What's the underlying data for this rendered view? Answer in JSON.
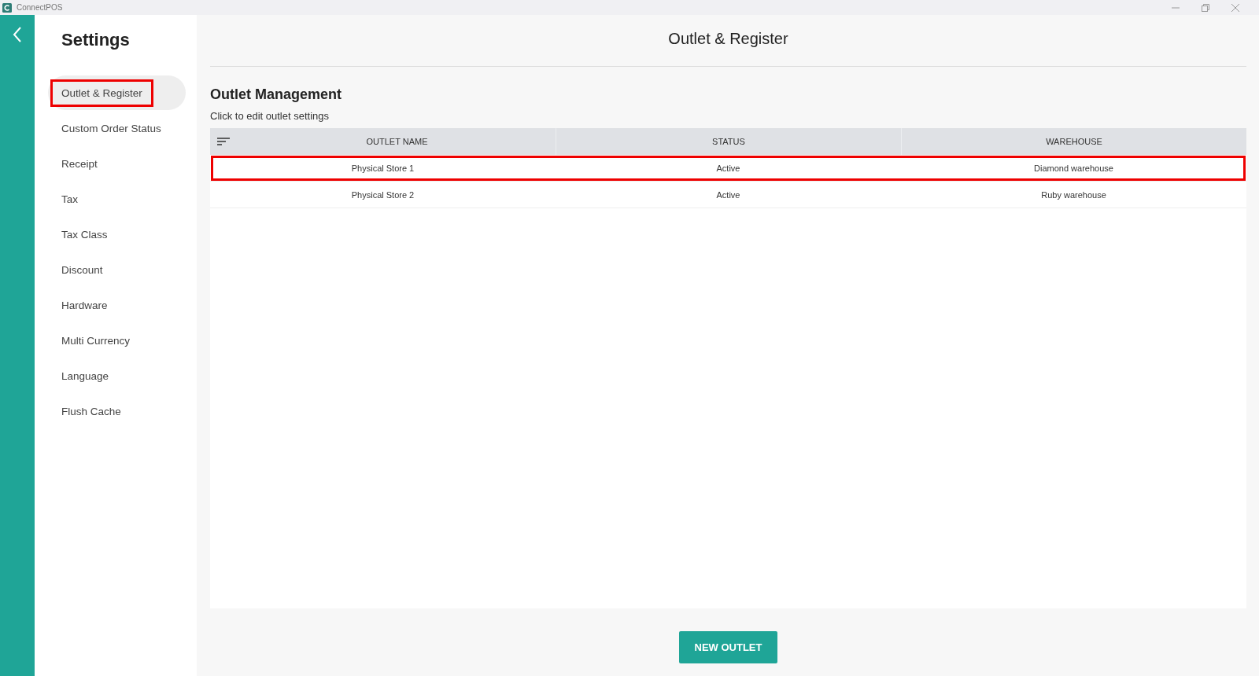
{
  "window": {
    "title": "ConnectPOS"
  },
  "sidebar": {
    "title": "Settings",
    "items": [
      {
        "label": "Outlet & Register",
        "selected": true,
        "highlighted": true
      },
      {
        "label": "Custom Order Status",
        "selected": false,
        "highlighted": false
      },
      {
        "label": "Receipt",
        "selected": false,
        "highlighted": false
      },
      {
        "label": "Tax",
        "selected": false,
        "highlighted": false
      },
      {
        "label": "Tax Class",
        "selected": false,
        "highlighted": false
      },
      {
        "label": "Discount",
        "selected": false,
        "highlighted": false
      },
      {
        "label": "Hardware",
        "selected": false,
        "highlighted": false
      },
      {
        "label": "Multi Currency",
        "selected": false,
        "highlighted": false
      },
      {
        "label": "Language",
        "selected": false,
        "highlighted": false
      },
      {
        "label": "Flush Cache",
        "selected": false,
        "highlighted": false
      }
    ]
  },
  "page": {
    "title": "Outlet & Register",
    "section_title": "Outlet Management",
    "hint": "Click to edit outlet settings"
  },
  "table": {
    "columns": [
      "OUTLET NAME",
      "STATUS",
      "WAREHOUSE"
    ],
    "rows": [
      {
        "cells": [
          "Physical Store 1",
          "Active",
          "Diamond warehouse"
        ],
        "highlighted": true
      },
      {
        "cells": [
          "Physical Store 2",
          "Active",
          "Ruby warehouse"
        ],
        "highlighted": false
      }
    ]
  },
  "new_button": "NEW OUTLET"
}
